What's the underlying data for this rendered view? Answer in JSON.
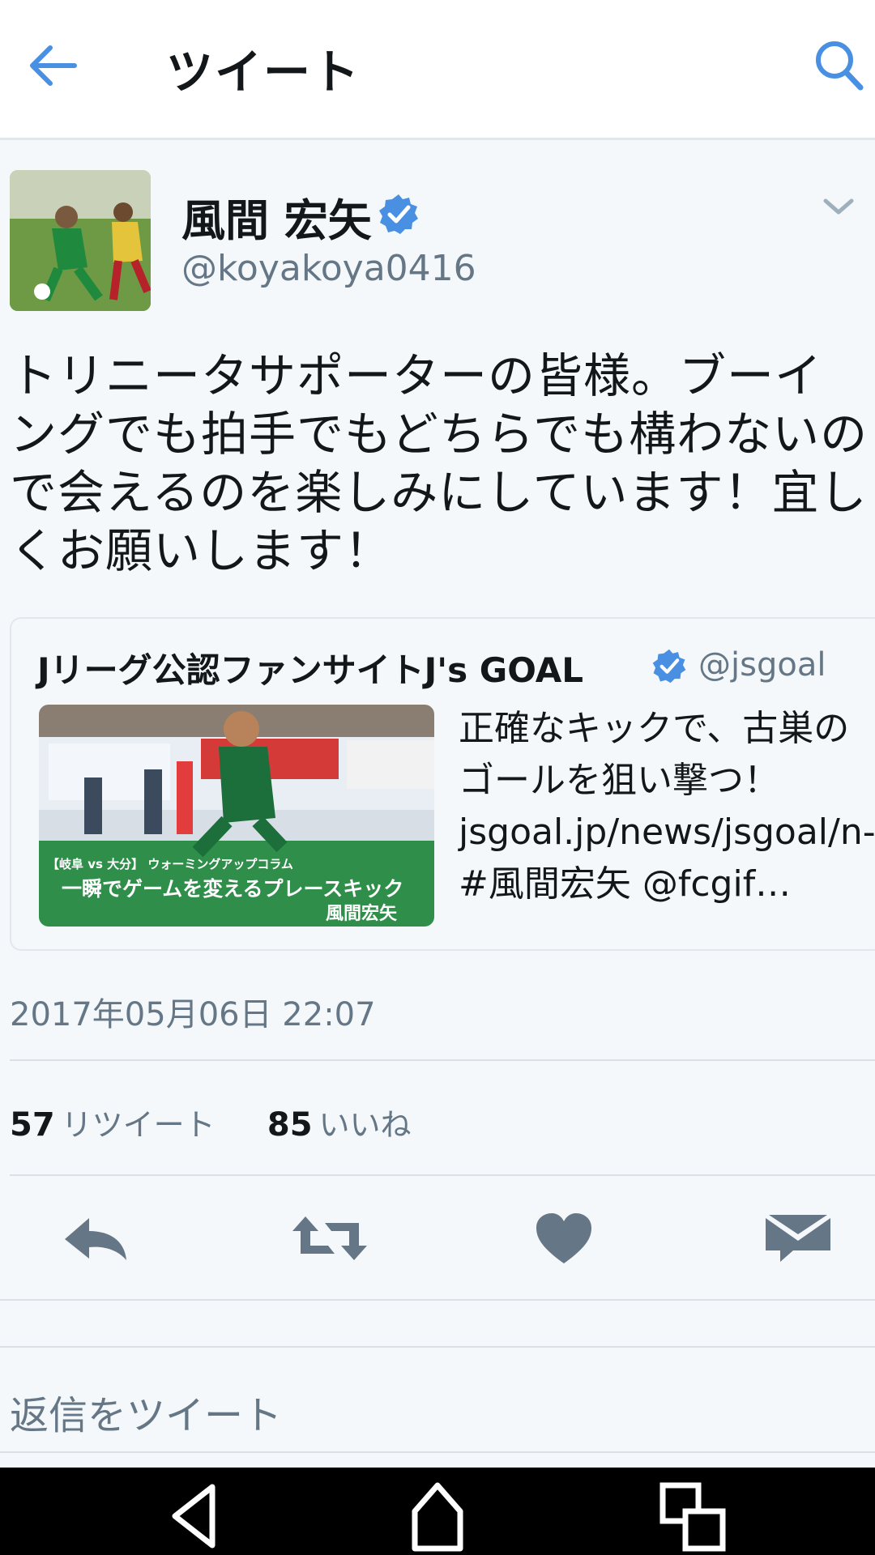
{
  "app_bar": {
    "title": "ツイート",
    "back_icon": "arrow-left-icon",
    "search_icon": "search-icon"
  },
  "tweet": {
    "author_name": "風間 宏矢",
    "handle": "@koyakoya0416",
    "text": "トリニータサポーターの皆様。ブーイングでも拍手でもどちらでも構わないので会えるのを楽しみにしています！宜しくお願いします！",
    "timestamp": "2017年05月06日 22:07"
  },
  "quoted": {
    "name": "Jリーグ公認ファンサイトJ's GOAL",
    "handle": "@jsgoal",
    "text": "正確なキックで、古巣のゴールを狙い撃つ！ jsgoal.jp/news/jsgoal/n-… #風間宏矢 @fcgif…",
    "image_caption_top": "【岐阜 vs 大分】 ウォーミングアップコラム",
    "image_caption_main": "一瞬でゲームを変えるプレースキック",
    "image_caption_name": "風間宏矢"
  },
  "stats": {
    "retweets_count": "57",
    "retweets_label": "リツイート",
    "likes_count": "85",
    "likes_label": "いいね"
  },
  "reply": {
    "placeholder": "返信をツイート"
  },
  "colors": {
    "accent": "#4a90e2",
    "verified": "#4a90e2",
    "secondary_text": "#657786",
    "action_icon": "#657786"
  }
}
